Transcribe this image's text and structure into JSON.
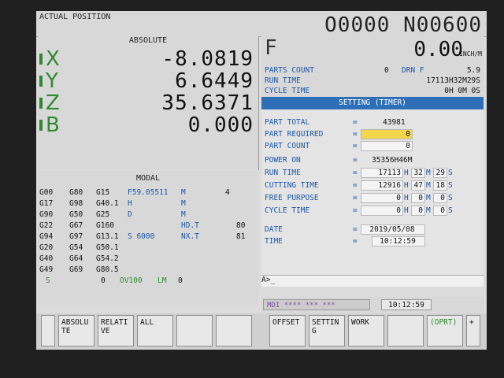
{
  "header": {
    "screen_title": "ACTUAL POSITION",
    "program_number": "O0000 N00600"
  },
  "absolute": {
    "heading": "ABSOLUTE",
    "axes": [
      {
        "name": "X",
        "value": "-8.0819"
      },
      {
        "name": "Y",
        "value": "6.6449"
      },
      {
        "name": "Z",
        "value": "35.6371"
      },
      {
        "name": "B",
        "value": "0.000"
      }
    ]
  },
  "feed": {
    "label": "F",
    "value": "0.00",
    "unit": "INCH/M"
  },
  "status_info": {
    "parts_count_label": "PARTS COUNT",
    "parts_count_value": "0",
    "drn_label": "DRN F",
    "drn_value": "5.9",
    "run_time_label": "RUN TIME",
    "run_time_value": "17113H32M29S",
    "cycle_time_label": "CYCLE TIME",
    "cycle_time_value": "0H 0M 0S"
  },
  "setting": {
    "heading": "SETTING (TIMER)",
    "part_total_label": "PART TOTAL",
    "part_total_value": "43981",
    "part_required_label": "PART REQUIRED",
    "part_required_value": "0",
    "part_count_label": "PART COUNT",
    "part_count_value": "0",
    "power_on_label": "POWER ON",
    "power_on_value": "35356H46M",
    "run_time_label": "RUN TIME",
    "run_time_h": "17113",
    "run_time_m": "32",
    "run_time_s": "29",
    "cutting_time_label": "CUTTING TIME",
    "cutting_time_h": "12916",
    "cutting_time_m": "47",
    "cutting_time_s": "18",
    "free_purpose_label": "FREE PURPOSE",
    "free_purpose_h": "0",
    "free_purpose_m": "0",
    "free_purpose_s": "0",
    "cycle_time_label": "CYCLE TIME",
    "cycle_time_h": "0",
    "cycle_time_m": "0",
    "cycle_time_s": "0",
    "date_label": "DATE",
    "date_value": "2019/05/08",
    "time_label": "TIME",
    "time_value": "10:12:59",
    "equals": "=",
    "unit_h": "H",
    "unit_m": "M",
    "unit_s": "S"
  },
  "prompt": "A>_",
  "modal": {
    "heading": "MODAL",
    "lines": [
      [
        "G00",
        "G80",
        "G15",
        "F59.05511",
        "M",
        "4"
      ],
      [
        "G17",
        "G98",
        "G40.1",
        "H",
        "M",
        ""
      ],
      [
        "G90",
        "G50",
        "G25",
        "D",
        "M",
        ""
      ],
      [
        "G22",
        "G67",
        "G160",
        "",
        "HD.T",
        "80"
      ],
      [
        "G94",
        "G97",
        "G13.1",
        "S   6000",
        "NX.T",
        "81"
      ],
      [
        "G20",
        "G54",
        "G50.1",
        "",
        "",
        ""
      ],
      [
        "G40",
        "G64",
        "G54.2",
        "",
        "",
        ""
      ],
      [
        "G49",
        "G69",
        "G80.5",
        "",
        "",
        ""
      ]
    ],
    "footer_s": "S",
    "footer_s_value": "0",
    "footer_ov": "OV100",
    "footer_lm": "LM",
    "footer_lm_value": "0"
  },
  "status_bar": {
    "mode": "MDI  **** *** ***",
    "clock": "10:12:59"
  },
  "softkeys": {
    "absolute": "ABSOLU TE",
    "relative": "RELATI VE",
    "all": "ALL",
    "offset": "OFFSET",
    "setting": "SETTIN G",
    "work": "WORK",
    "oprt": "(OPRT)",
    "plus": "+"
  }
}
